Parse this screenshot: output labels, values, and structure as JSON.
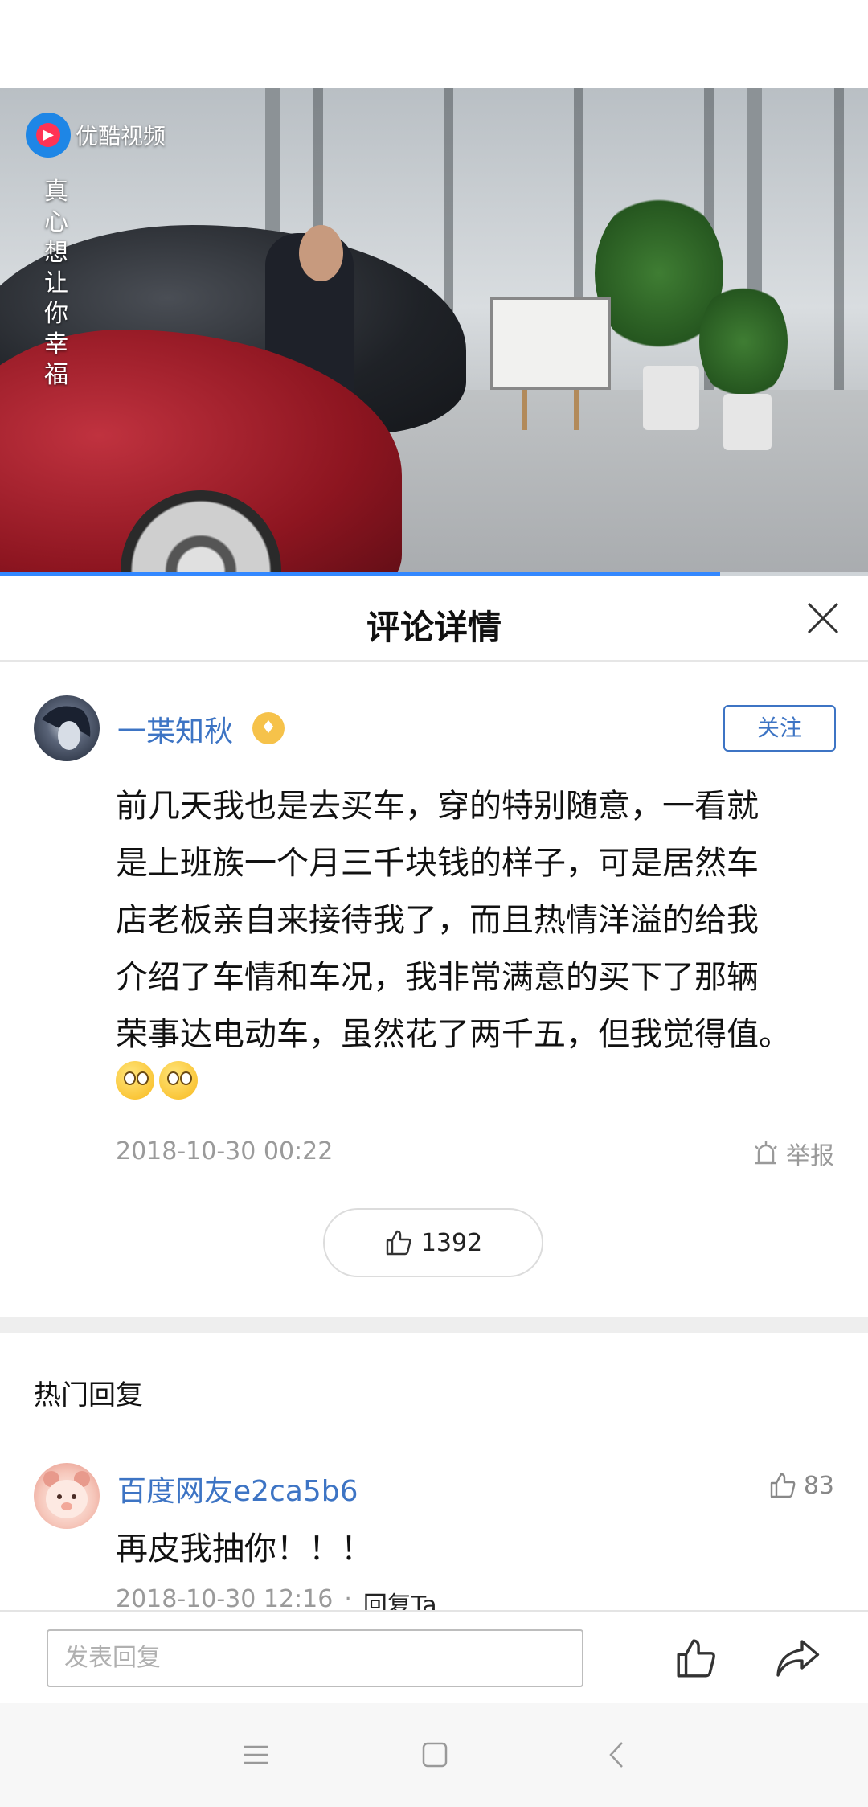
{
  "video": {
    "logo_text": "优酷视频",
    "caption": "真心想让你幸福",
    "progress": 0.83
  },
  "header": {
    "title": "评论详情"
  },
  "comment": {
    "username": "一枼知秋",
    "follow_label": "关注",
    "lines": [
      "前几天我也是去买车，穿的特别随意，一看就",
      "是上班族一个月三千块钱的样子，可是居然车",
      "店老板亲自来接待我了，而且热情洋溢的给我",
      "介绍了车情和车况，我非常满意的买下了那辆",
      "荣事达电动车，虽然花了两千五，但我觉得值。"
    ],
    "timestamp": "2018-10-30 00:22",
    "report_label": "举报",
    "like_count": "1392"
  },
  "hot_replies": {
    "title": "热门回复",
    "items": [
      {
        "username": "百度网友e2ca5b6",
        "likes": "83",
        "text": "再皮我抽你！！！",
        "timestamp": "2018-10-30 12:16",
        "separator": "·",
        "reply_label": "回复Ta"
      }
    ]
  },
  "compose": {
    "placeholder": "发表回复"
  },
  "colors": {
    "link": "#3d74c4",
    "progress": "#3388ff"
  }
}
